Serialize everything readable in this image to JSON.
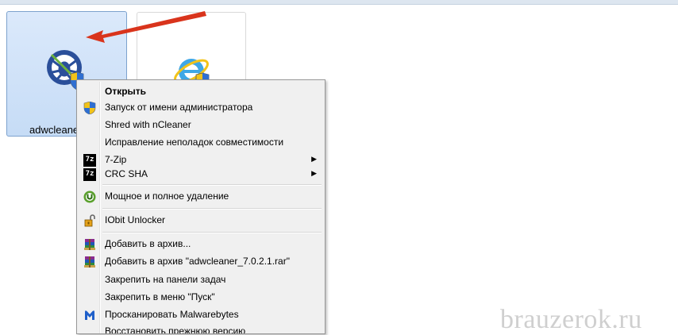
{
  "files": {
    "adwcleaner_label": "adwcleaner_",
    "ie_label": ""
  },
  "context_menu": {
    "items": [
      {
        "label": "Открыть",
        "icon": "none",
        "bold": true
      },
      {
        "label": "Запуск от имени администратора",
        "icon": "uac-shield-icon"
      },
      {
        "label": "Shred with nCleaner",
        "icon": "none"
      },
      {
        "label": "Исправление неполадок совместимости",
        "icon": "none"
      },
      {
        "label": "7-Zip",
        "icon": "7zip-icon",
        "submenu": true
      },
      {
        "label": "CRC SHA",
        "icon": "7zip-icon",
        "submenu": true
      },
      {
        "label": "Мощное и полное удаление",
        "icon": "iobit-uninstaller-icon"
      },
      {
        "label": "IObit Unlocker",
        "icon": "unlocker-lock-icon"
      },
      {
        "label": "Добавить в архив...",
        "icon": "winrar-icon"
      },
      {
        "label": "Добавить в архив \"adwcleaner_7.0.2.1.rar\"",
        "icon": "winrar-icon"
      },
      {
        "label": "Закрепить на панели задач",
        "icon": "none"
      },
      {
        "label": "Закрепить в меню \"Пуск\"",
        "icon": "none"
      },
      {
        "label": "Просканировать Malwarebytes",
        "icon": "malwarebytes-icon"
      },
      {
        "label": "Восстановить прежнюю версию",
        "icon": "none"
      }
    ],
    "submenu_glyph": "▶",
    "zip_glyph": "7z"
  },
  "colors": {
    "arrow": "#d9341c",
    "selection_tile": "#c6dcf6",
    "menu_bg": "#f0f0f0"
  },
  "watermark": "brauzerok.ru"
}
